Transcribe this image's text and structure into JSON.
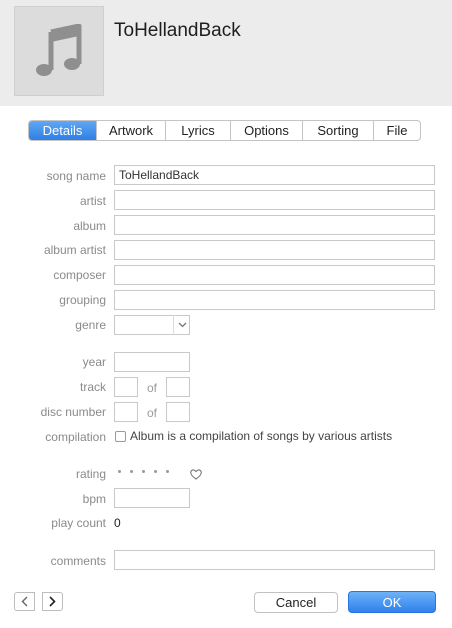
{
  "header": {
    "title": "ToHellandBack"
  },
  "tabs": [
    {
      "label": "Details",
      "active": true
    },
    {
      "label": "Artwork",
      "active": false
    },
    {
      "label": "Lyrics",
      "active": false
    },
    {
      "label": "Options",
      "active": false
    },
    {
      "label": "Sorting",
      "active": false
    },
    {
      "label": "File",
      "active": false
    }
  ],
  "labels": {
    "song_name": "song name",
    "artist": "artist",
    "album": "album",
    "album_artist": "album artist",
    "composer": "composer",
    "grouping": "grouping",
    "genre": "genre",
    "year": "year",
    "track": "track",
    "disc_number": "disc number",
    "compilation": "compilation",
    "rating": "rating",
    "bpm": "bpm",
    "play_count": "play count",
    "comments": "comments",
    "of": "of"
  },
  "values": {
    "song_name": "ToHellandBack",
    "artist": "",
    "album": "",
    "album_artist": "",
    "composer": "",
    "grouping": "",
    "genre": "",
    "year": "",
    "track_number": "",
    "track_total": "",
    "disc_number": "",
    "disc_total": "",
    "bpm": "",
    "comments": "",
    "play_count": "0",
    "compilation_checked": false,
    "rating": 0
  },
  "compilation_text": "Album is a compilation of songs by various artists",
  "buttons": {
    "cancel": "Cancel",
    "ok": "OK"
  },
  "icons": {
    "artwork": "music-note-icon",
    "prev": "chevron-left-icon",
    "next": "chevron-right-icon",
    "genre_dropdown": "chevron-down-icon",
    "love": "heart-icon"
  },
  "colors": {
    "accent": "#2f82ec",
    "header_bg": "#ececec",
    "label": "#8a8a8a"
  }
}
